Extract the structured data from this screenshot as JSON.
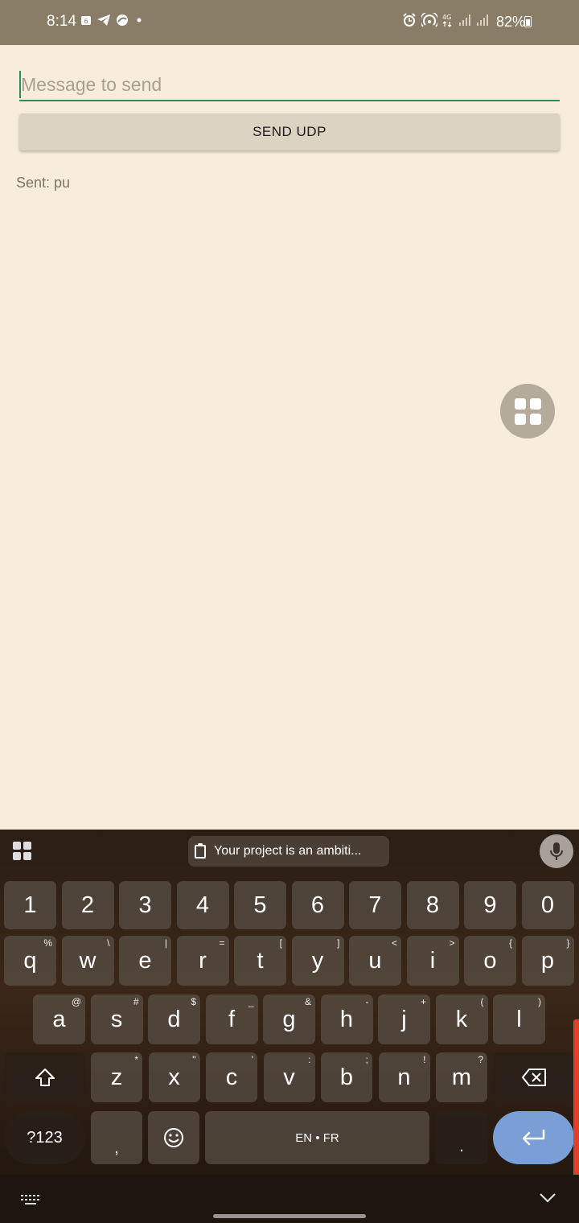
{
  "status_bar": {
    "time": "8:14",
    "battery": "82%"
  },
  "form": {
    "input_placeholder": "Message to send",
    "input_value": "",
    "send_button": "SEND UDP",
    "sent_status": "Sent: pu"
  },
  "keyboard": {
    "clipboard_suggestion": "Your project is an ambiti...",
    "number_row": [
      "1",
      "2",
      "3",
      "4",
      "5",
      "6",
      "7",
      "8",
      "9",
      "0"
    ],
    "row1": [
      {
        "k": "q",
        "s": "%"
      },
      {
        "k": "w",
        "s": "\\"
      },
      {
        "k": "e",
        "s": "|"
      },
      {
        "k": "r",
        "s": "="
      },
      {
        "k": "t",
        "s": "["
      },
      {
        "k": "y",
        "s": "]"
      },
      {
        "k": "u",
        "s": "<"
      },
      {
        "k": "i",
        "s": ">"
      },
      {
        "k": "o",
        "s": "{"
      },
      {
        "k": "p",
        "s": "}"
      }
    ],
    "row2": [
      {
        "k": "a",
        "s": "@"
      },
      {
        "k": "s",
        "s": "#"
      },
      {
        "k": "d",
        "s": "$"
      },
      {
        "k": "f",
        "s": "_"
      },
      {
        "k": "g",
        "s": "&"
      },
      {
        "k": "h",
        "s": "-"
      },
      {
        "k": "j",
        "s": "+"
      },
      {
        "k": "k",
        "s": "("
      },
      {
        "k": "l",
        "s": ")"
      }
    ],
    "row3": [
      {
        "k": "z",
        "s": "*"
      },
      {
        "k": "x",
        "s": "\""
      },
      {
        "k": "c",
        "s": "'"
      },
      {
        "k": "v",
        "s": ":"
      },
      {
        "k": "b",
        "s": ";"
      },
      {
        "k": "n",
        "s": "!"
      },
      {
        "k": "m",
        "s": "?"
      }
    ],
    "symbols_key": "?123",
    "comma_key": ",",
    "space_label": "EN • FR",
    "period_key": "."
  },
  "icons": {
    "status_left": [
      "notification-icon",
      "telegram-icon",
      "app-icon",
      "dot-icon"
    ],
    "status_right": [
      "alarm-icon",
      "hotspot-icon",
      "4g-icon",
      "signal-icon",
      "signal-icon",
      "battery-icon"
    ],
    "accent": "#2e8a5c",
    "enter_color": "#7a9fd6"
  }
}
